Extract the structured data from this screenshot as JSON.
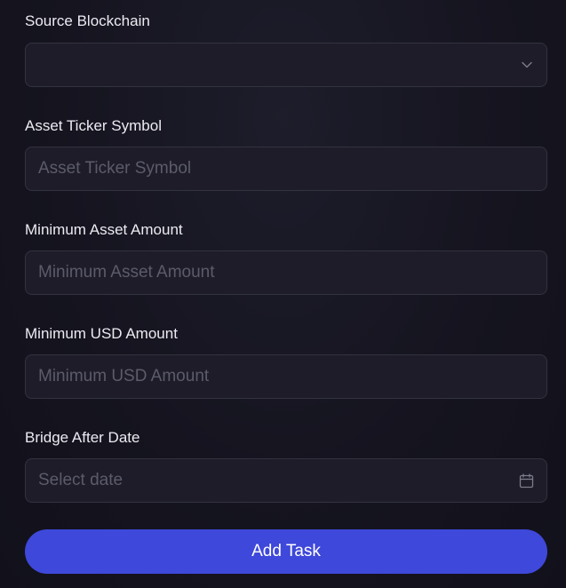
{
  "form": {
    "source_blockchain": {
      "label": "Source Blockchain",
      "value": "",
      "icon": "chevron-down-icon"
    },
    "asset_ticker": {
      "label": "Asset Ticker Symbol",
      "placeholder": "Asset Ticker Symbol"
    },
    "min_asset_amount": {
      "label": "Minimum Asset Amount",
      "placeholder": "Minimum Asset Amount"
    },
    "min_usd_amount": {
      "label": "Minimum USD Amount",
      "placeholder": "Minimum USD Amount"
    },
    "bridge_after_date": {
      "label": "Bridge After Date",
      "placeholder": "Select date",
      "icon": "calendar-icon"
    },
    "submit_label": "Add Task"
  },
  "colors": {
    "background": "#15141f",
    "field_background": "#1d1c28",
    "field_border": "#33323f",
    "placeholder": "#5c5b6b",
    "accent": "#3e48da"
  }
}
